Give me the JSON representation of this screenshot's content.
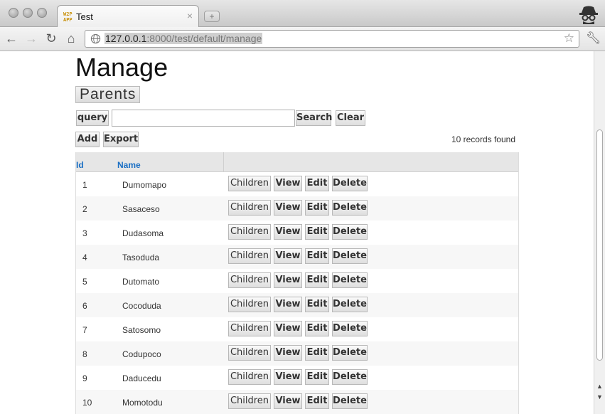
{
  "browser": {
    "tab_title": "Test",
    "tab_close": "×",
    "favicon_text": "W2P APP",
    "new_tab": "+",
    "url_host": "127.0.0.1",
    "url_rest": ":8000/test/default/manage"
  },
  "page": {
    "title": "Manage",
    "section": "Parents",
    "query_label": "query",
    "query_value": "",
    "search_label": "Search",
    "clear_label": "Clear",
    "add_label": "Add",
    "export_label": "Export",
    "records_found": "10 records found",
    "columns": {
      "id": "Id",
      "name": "Name"
    },
    "row_actions": {
      "children": "Children",
      "view": "View",
      "edit": "Edit",
      "delete": "Delete"
    },
    "rows": [
      {
        "id": "1",
        "name": "Dumomapo"
      },
      {
        "id": "2",
        "name": "Sasaceso"
      },
      {
        "id": "3",
        "name": "Dudasoma"
      },
      {
        "id": "4",
        "name": "Tasoduda"
      },
      {
        "id": "5",
        "name": "Dutomato"
      },
      {
        "id": "6",
        "name": "Cocoduda"
      },
      {
        "id": "7",
        "name": "Satosomo"
      },
      {
        "id": "8",
        "name": "Codupoco"
      },
      {
        "id": "9",
        "name": "Daducedu"
      },
      {
        "id": "10",
        "name": "Momotodu"
      }
    ]
  },
  "icons": [
    "back-icon",
    "forward-icon",
    "reload-icon",
    "home-icon",
    "globe-icon",
    "bookmark-star-icon",
    "wrench-icon",
    "incognito-icon"
  ],
  "colors": {
    "link": "#1a6fc4",
    "header_bg": "#e6e6e6"
  }
}
